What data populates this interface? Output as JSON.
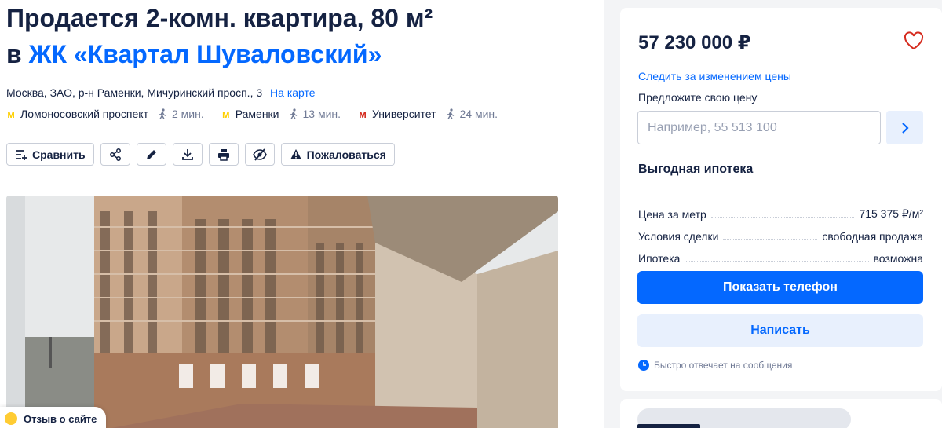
{
  "header": {
    "title_line1": "Продается 2-комн. квартира, 80 м²",
    "title_prefix": "в ",
    "complex_link": "ЖК «Квартал Шуваловский»"
  },
  "address": {
    "text": "Москва, ЗАО, р-н Раменки, Мичуринский просп., 3",
    "map_link": "На карте"
  },
  "metro": [
    {
      "logo": "м",
      "color": "yellow",
      "station": "Ломоносовский проспект",
      "walk": "2 мин."
    },
    {
      "logo": "м",
      "color": "yellow",
      "station": "Раменки",
      "walk": "13 мин."
    },
    {
      "logo": "м",
      "color": "red",
      "station": "Университет",
      "walk": "24 мин."
    }
  ],
  "toolbar": {
    "compare_label": "Сравнить",
    "complain_label": "Пожаловаться",
    "icons": [
      "compare-icon",
      "share-icon",
      "edit-icon",
      "download-icon",
      "print-icon",
      "hide-icon",
      "warning-icon"
    ]
  },
  "feedback": {
    "label": "Отзыв о сайте"
  },
  "card": {
    "price": "57 230 000 ₽",
    "follow_price": "Следить за изменением цены",
    "offer_label": "Предложите свою цену",
    "offer_placeholder": "Например, 55 513 100",
    "mortgage_title": "Выгодная ипотека",
    "rows": [
      {
        "key": "Цена за метр",
        "value": "715 375 ₽/м²"
      },
      {
        "key": "Условия сделки",
        "value": "свободная продажа"
      },
      {
        "key": "Ипотека",
        "value": "возможна"
      }
    ],
    "show_phone": "Показать телефон",
    "write": "Написать",
    "fast_reply": "Быстро отвечает на сообщения"
  },
  "colors": {
    "accent": "#0468ff",
    "text": "#152242",
    "metro_yellow": "#ffd000",
    "metro_red": "#d52b1e"
  }
}
